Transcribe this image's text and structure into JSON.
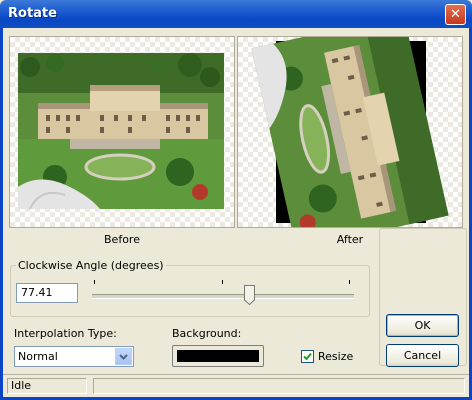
{
  "window": {
    "title": "Rotate",
    "close_icon": "close-icon"
  },
  "preview": {
    "before_caption": "Before",
    "after_caption": "After"
  },
  "angle": {
    "group_label": "Clockwise Angle (degrees)",
    "value": "77.41",
    "slider_fraction": 0.61
  },
  "interpolation": {
    "label": "Interpolation Type:",
    "selected": "Normal"
  },
  "background": {
    "label": "Background:",
    "color": "#000000"
  },
  "resize": {
    "label": "Resize",
    "checked": true
  },
  "buttons": {
    "ok": "OK",
    "cancel": "Cancel"
  },
  "status": {
    "text": "Idle"
  },
  "colors": {
    "titlebar": "#0a47c6",
    "dialog_bg": "#ece9d8",
    "photo_grass": "#4f8a2f",
    "photo_building": "#d8c8a6"
  }
}
